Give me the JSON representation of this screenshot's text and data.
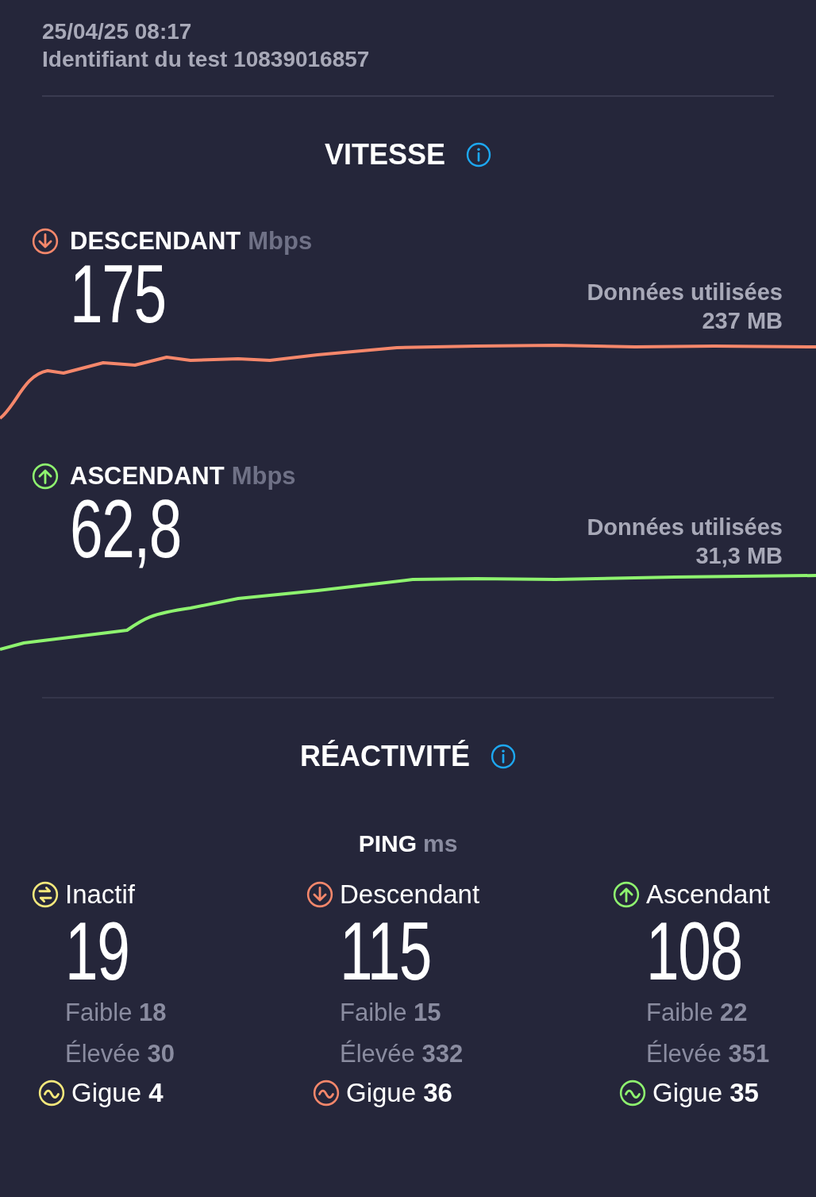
{
  "header": {
    "date": "25/04/25 08:17",
    "test_id": "Identifiant du test 10839016857"
  },
  "speed": {
    "title": "VITESSE",
    "metrics": [
      {
        "kind": "download",
        "color": "#f5876b",
        "label": "DESCENDANT",
        "unit": "Mbps",
        "value": "175",
        "data_label": "Données utilisées",
        "data_value": "237 MB"
      },
      {
        "kind": "upload",
        "color": "#8ef36f",
        "label": "ASCENDANT",
        "unit": "Mbps",
        "value": "62,8",
        "data_label": "Données utilisées",
        "data_value": "31,3 MB"
      }
    ]
  },
  "responsiveness": {
    "title": "RÉACTIVITÉ",
    "ping_label": "PING",
    "ping_unit": "ms",
    "columns": [
      {
        "kind": "idle",
        "color": "#f5e87c",
        "label": "Inactif",
        "value": "19",
        "low_label": "Faible",
        "low": "18",
        "high_label": "Élevée",
        "high": "30",
        "jitter_label": "Gigue",
        "jitter": "4"
      },
      {
        "kind": "download",
        "color": "#f5876b",
        "label": "Descendant",
        "value": "115",
        "low_label": "Faible",
        "low": "15",
        "high_label": "Élevée",
        "high": "332",
        "jitter_label": "Gigue",
        "jitter": "36"
      },
      {
        "kind": "upload",
        "color": "#8ef36f",
        "label": "Ascendant",
        "value": "108",
        "low_label": "Faible",
        "low": "22",
        "high_label": "Élevée",
        "high": "351",
        "jitter_label": "Gigue",
        "jitter": "35"
      }
    ]
  }
}
